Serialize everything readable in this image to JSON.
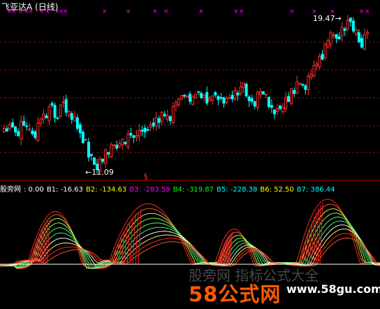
{
  "window": {
    "title": "飞亚达A (日线)"
  },
  "price_labels": {
    "high": "19.47",
    "low": "11.09"
  },
  "indicator": {
    "name": "股旁网",
    "value0": ": 0.00",
    "lines": [
      {
        "key": "B1",
        "text": "B1: -16.63",
        "color": "#ffffff"
      },
      {
        "key": "B2",
        "text": "B2: -134.63",
        "color": "#ffff00"
      },
      {
        "key": "B3",
        "text": "B3: -283.59",
        "color": "#ff00ff"
      },
      {
        "key": "B4",
        "text": "B4: -319.87",
        "color": "#00ff00"
      },
      {
        "key": "B5",
        "text": "B5: -228.38",
        "color": "#00ffff"
      },
      {
        "key": "B6",
        "text": "B6: 52.50",
        "color": "#ffff00"
      },
      {
        "key": "B7",
        "text": "B7: 386.44",
        "color": "#00ffff"
      }
    ]
  },
  "watermark": {
    "brand": "58公式网",
    "url": "www.58gu.com",
    "faded": "股旁网 指标公式大全"
  },
  "colors": {
    "up": "#ff3030",
    "down": "#00ffff",
    "grid": "#8b1010",
    "marker": "#ff00ff",
    "sep": "#c00000"
  },
  "chart_data": {
    "type": "candlestick",
    "series": [
      {
        "name": "price_close",
        "values": [
          13.2,
          13.4,
          13.0,
          13.6,
          13.3,
          12.9,
          13.5,
          14.0,
          14.4,
          13.8,
          14.5,
          14.1,
          13.7,
          13.2,
          12.4,
          11.6,
          11.2,
          11.5,
          12.0,
          12.3,
          12.1,
          12.6,
          12.9,
          12.7,
          13.1,
          13.0,
          13.4,
          13.8,
          14.1,
          13.9,
          14.4,
          14.8,
          15.0,
          14.7,
          15.1,
          14.9,
          14.6,
          15.0,
          14.8,
          14.6,
          14.9,
          15.3,
          15.5,
          15.0,
          14.7,
          15.2,
          15.1,
          14.4,
          14.0,
          14.3,
          14.9,
          15.4,
          15.8,
          15.6,
          16.1,
          16.7,
          17.2,
          17.9,
          18.5,
          18.2,
          18.8,
          19.2,
          18.6,
          18.0,
          18.4
        ]
      },
      {
        "name": "price_low_marker",
        "values": [
          11.09
        ]
      },
      {
        "name": "price_high_marker",
        "values": [
          19.47
        ]
      }
    ]
  }
}
